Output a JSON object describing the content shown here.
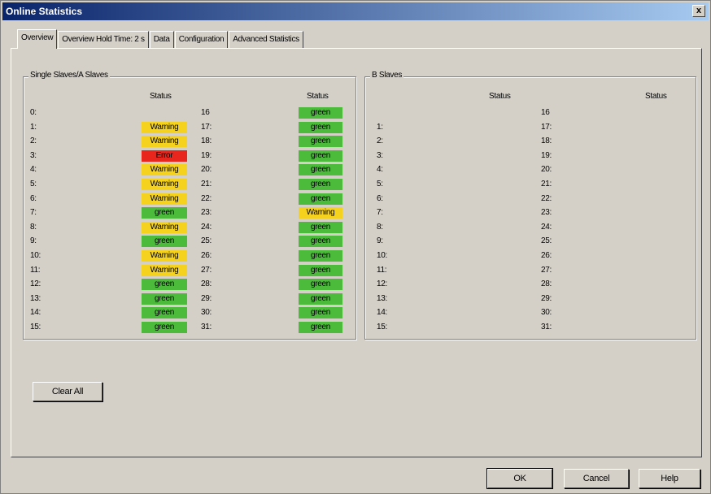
{
  "window": {
    "title": "Online Statistics",
    "close": "x"
  },
  "tabs": [
    "Overview",
    "Overview  Hold Time: 2 s",
    "Data",
    "Configuration",
    "Advanced Statistics"
  ],
  "single_slaves": {
    "label": "Single Slaves/A Slaves",
    "status_header": "Status",
    "left": [
      {
        "id": "0:",
        "status": ""
      },
      {
        "id": "1:",
        "status": "Warning"
      },
      {
        "id": "2:",
        "status": "Warning"
      },
      {
        "id": "3:",
        "status": "Error"
      },
      {
        "id": "4:",
        "status": "Warning"
      },
      {
        "id": "5:",
        "status": "Warning"
      },
      {
        "id": "6:",
        "status": "Warning"
      },
      {
        "id": "7:",
        "status": "green"
      },
      {
        "id": "8:",
        "status": "Warning"
      },
      {
        "id": "9:",
        "status": "green"
      },
      {
        "id": "10:",
        "status": "Warning"
      },
      {
        "id": "11:",
        "status": "Warning"
      },
      {
        "id": "12:",
        "status": "green"
      },
      {
        "id": "13:",
        "status": "green"
      },
      {
        "id": "14:",
        "status": "green"
      },
      {
        "id": "15:",
        "status": "green"
      }
    ],
    "right": [
      {
        "id": "16",
        "status": "green"
      },
      {
        "id": "17:",
        "status": "green"
      },
      {
        "id": "18:",
        "status": "green"
      },
      {
        "id": "19:",
        "status": "green"
      },
      {
        "id": "20:",
        "status": "green"
      },
      {
        "id": "21:",
        "status": "green"
      },
      {
        "id": "22:",
        "status": "green"
      },
      {
        "id": "23:",
        "status": "Warning"
      },
      {
        "id": "24:",
        "status": "green"
      },
      {
        "id": "25:",
        "status": "green"
      },
      {
        "id": "26:",
        "status": "green"
      },
      {
        "id": "27:",
        "status": "green"
      },
      {
        "id": "28:",
        "status": "green"
      },
      {
        "id": "29:",
        "status": "green"
      },
      {
        "id": "30:",
        "status": "green"
      },
      {
        "id": "31:",
        "status": "green"
      }
    ]
  },
  "b_slaves": {
    "label": "B Slaves",
    "status_header": "Status",
    "left": [
      "",
      "1:",
      "2:",
      "3:",
      "4:",
      "5:",
      "6:",
      "7:",
      "8:",
      "9:",
      "10:",
      "11:",
      "12:",
      "13:",
      "14:",
      "15:"
    ],
    "right": [
      "16",
      "17:",
      "18:",
      "19:",
      "20:",
      "21:",
      "22:",
      "23:",
      "24:",
      "25:",
      "26:",
      "27:",
      "28:",
      "29:",
      "30:",
      "31:"
    ]
  },
  "buttons": {
    "clear_all": "Clear All",
    "ok": "OK",
    "cancel": "Cancel",
    "help": "Help"
  },
  "colors": {
    "green": "#4cbb3c",
    "warning": "#f5d21e",
    "error": "#e8261e"
  }
}
